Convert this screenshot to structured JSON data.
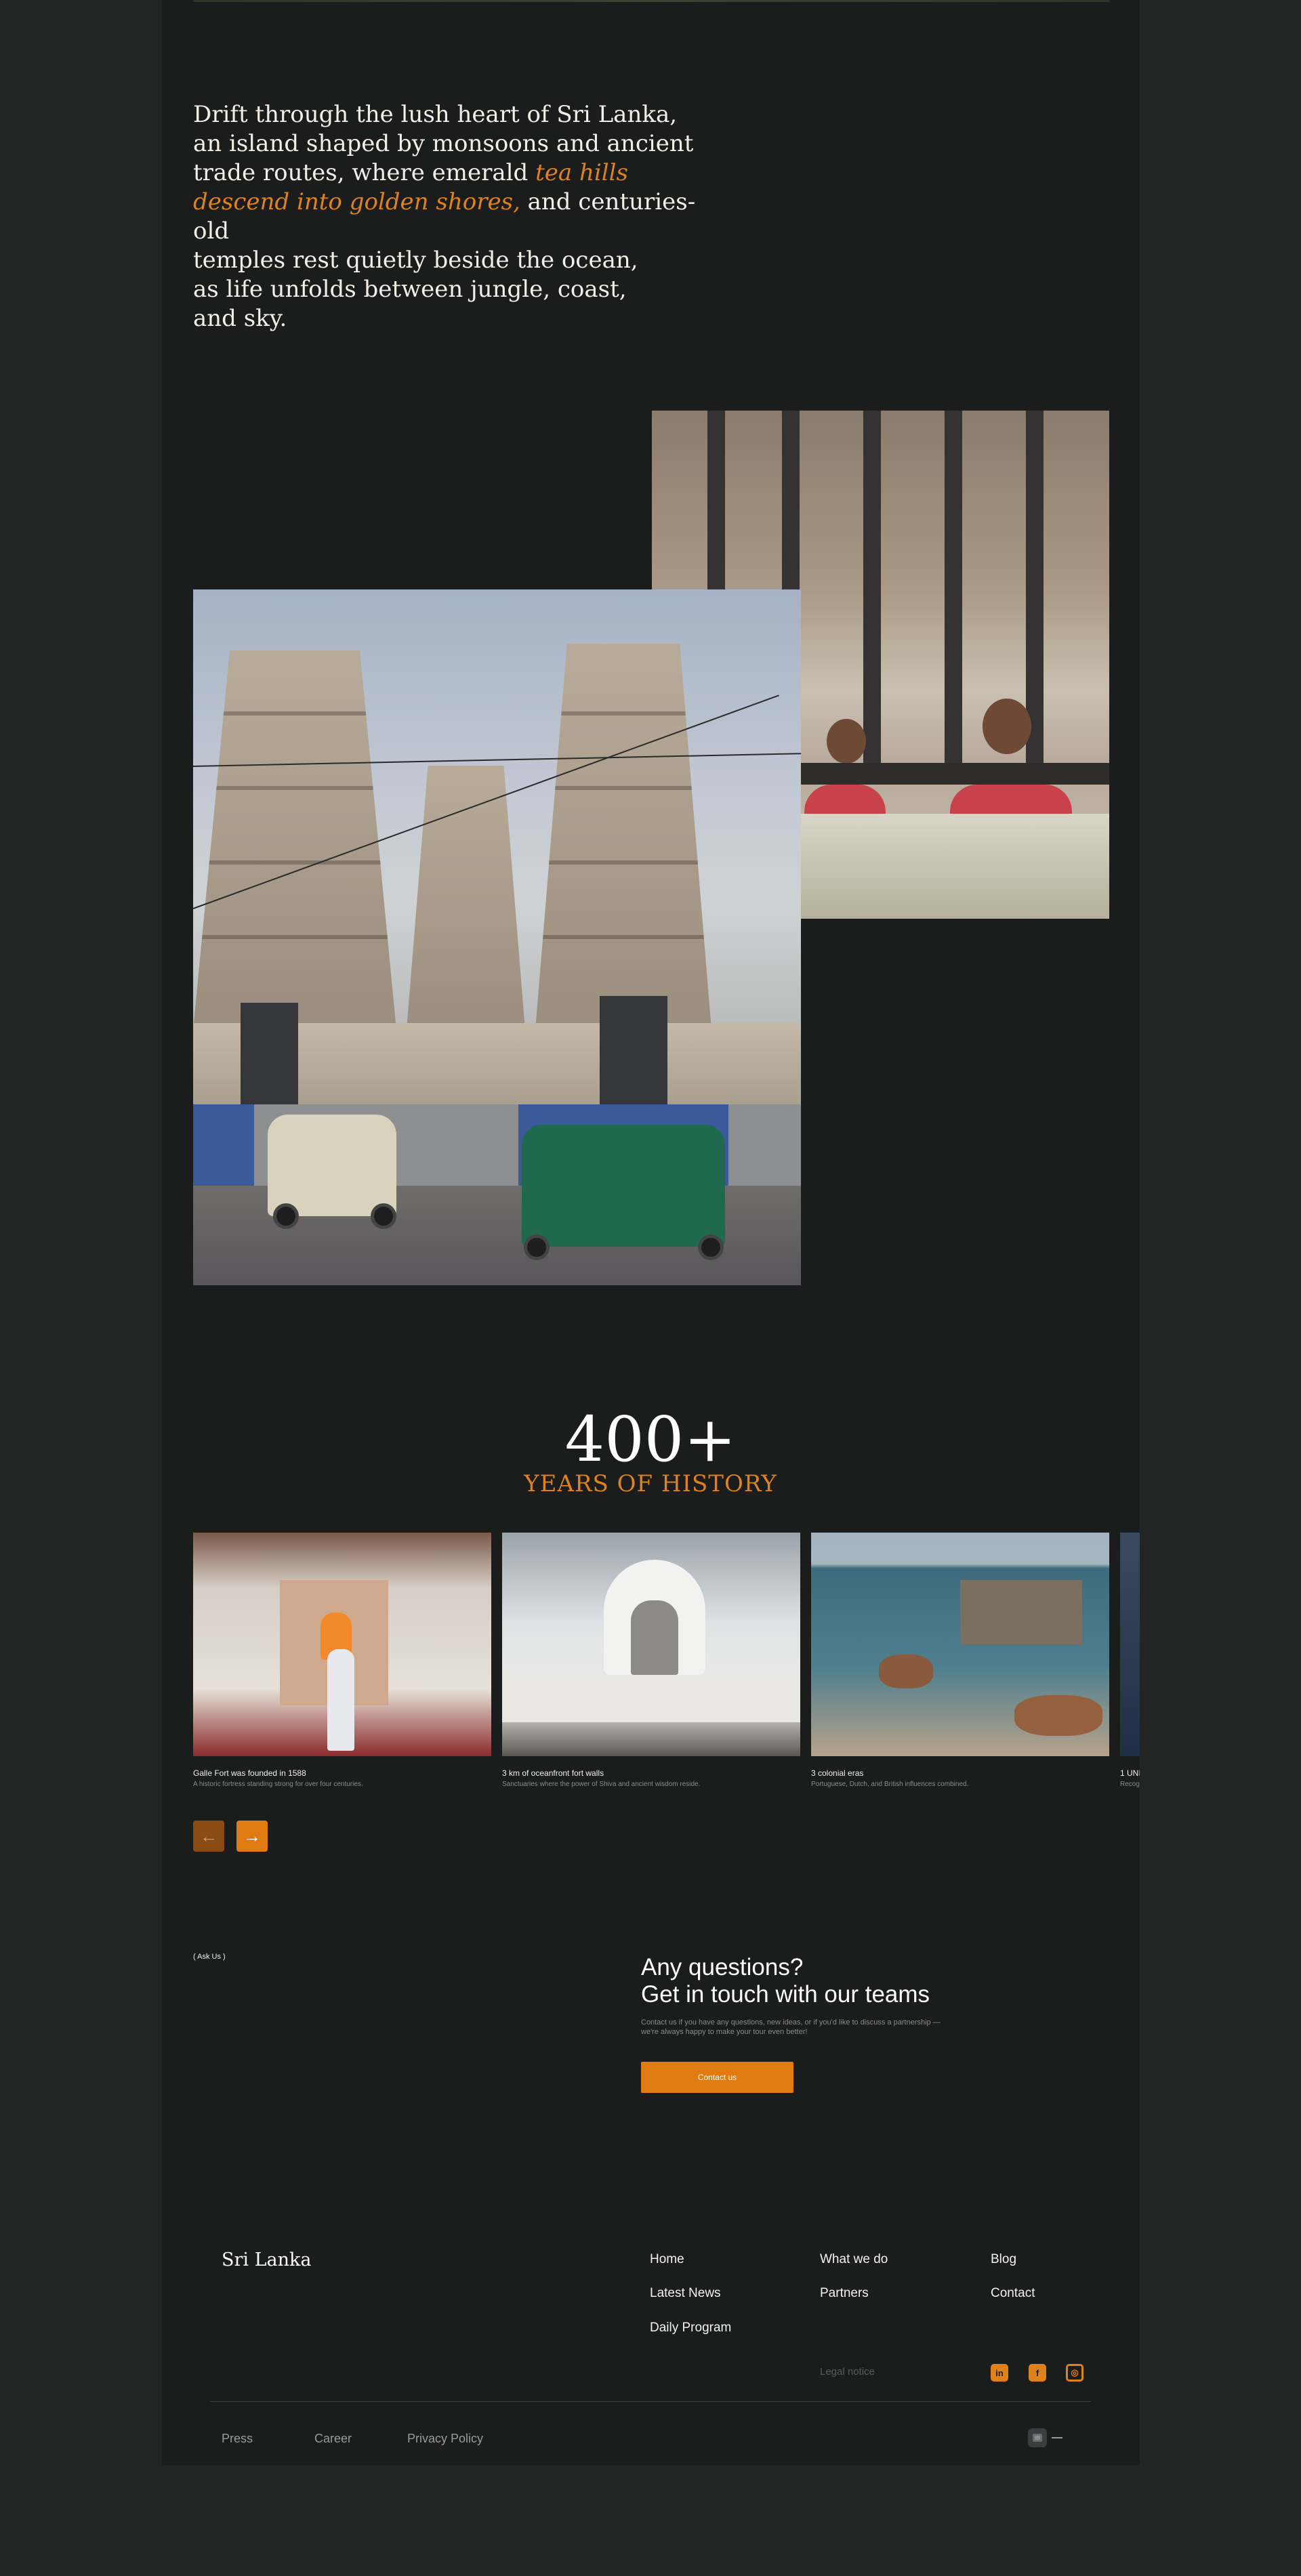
{
  "intro": {
    "line_1": "Drift through the lush heart of Sri Lanka,",
    "line_2": "an island shaped by monsoons and ancient",
    "line_3": "trade routes, where emerald",
    "accent_1": "tea hills",
    "accent_2": "descend into golden shores,",
    "line_4": "and centuries-old",
    "line_5": "temples rest quietly beside the ocean,",
    "line_6": "as life unfolds between jungle, coast,",
    "line_7": "and sky."
  },
  "stat": {
    "number": "400+",
    "label": "YEARS OF HISTORY"
  },
  "carousel": {
    "cards": [
      {
        "title": "Galle Fort was founded in 1588",
        "desc": "A historic fortress standing strong for over four centuries."
      },
      {
        "title": "3 km of oceanfront fort walls",
        "desc": "Sanctuaries where the power of Shiva and ancient wisdom reside."
      },
      {
        "title": "3 colonial eras",
        "desc": "Portuguese, Dutch, and British influences combined."
      },
      {
        "title": "1 UNI",
        "desc": "Recog"
      }
    ],
    "prev_label": "←",
    "next_label": "→"
  },
  "contact": {
    "tag": "( Ask Us )",
    "title_line_1": "Any questions?",
    "title_line_2": "Get in touch with our teams",
    "text_line_1": "Contact us if you have any questions, new ideas, or if you'd like to discuss a partnership —",
    "text_line_2": "we're always happy to make your tour even better!",
    "button_label": "Contact us"
  },
  "footer": {
    "brand": "Sri Lanka",
    "links": {
      "home": "Home",
      "what_we_do": "What we do",
      "blog": "Blog",
      "latest_news": "Latest News",
      "partners": "Partners",
      "contact": "Contact",
      "daily_program": "Daily Program"
    },
    "legal": "Legal notice",
    "social": {
      "linkedin": "in",
      "facebook": "f",
      "instagram": "◎"
    },
    "bottom": {
      "press": "Press",
      "career": "Career",
      "privacy": "Privacy Policy"
    }
  },
  "colors": {
    "accent": "#e0821c",
    "page_bg": "#1b1c1c",
    "outer_bg": "#232424"
  }
}
